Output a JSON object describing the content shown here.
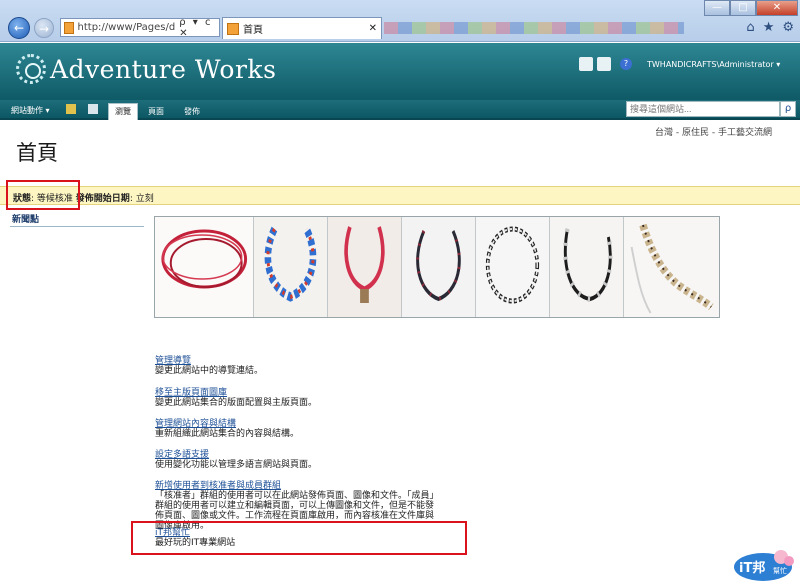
{
  "browser": {
    "address": "http://www/Pages/d",
    "address_controls": "ρ ▾ c ✕",
    "tab_title": "首頁",
    "tab_close": "✕",
    "back_glyph": "←",
    "forward_glyph": "→",
    "controls": [
      "—",
      "□",
      "✕"
    ],
    "right_icons": [
      "⌂",
      "★",
      "⚙"
    ]
  },
  "site": {
    "title": "Adventure Works",
    "user": "TWHANDICRAFTS\\Administrator ▾",
    "help_glyph": "?"
  },
  "ribbon": {
    "site_actions": "網站動作 ▾",
    "tabs": [
      "瀏覽",
      "頁面",
      "發佈"
    ],
    "active_tab": 0,
    "search_placeholder": "搜尋這個網站...",
    "search_glyph": "ρ"
  },
  "page": {
    "breadcrumb": "台灣 - 原住民 - 手工藝交流網",
    "title": "首頁",
    "status_label": "狀態",
    "status_value": ": 等候核准",
    "publish_label": "發佈開始日期",
    "publish_value": ": 立刻",
    "news_heading": "新聞點"
  },
  "links": [
    {
      "title": "管理導覽",
      "desc": "變更此網站中的導覽連結。"
    },
    {
      "title": "移至主版頁面圖庫",
      "desc": "變更此網站集合的版面配置與主版頁面。"
    },
    {
      "title": "管理網站內容與結構",
      "desc": "重新組織此網站集合的內容與結構。"
    },
    {
      "title": "設定多語支援",
      "desc": "使用變化功能以管理多語言網站與頁面。"
    },
    {
      "title": "新增使用者到核准者與成員群組",
      "desc": "「核准者」群組的使用者可以在此網站發佈頁面、圖像和文件。「成員」群組的使用者可以建立和編輯頁面，可以上傳圖像和文件，但是不能發佈頁面、圖像或文件。工作流程在頁面庫啟用，而內容核准在文件庫與圖像庫啟用。"
    },
    {
      "title": "iT邦幫忙",
      "desc": "最好玩的IT專業網站"
    }
  ],
  "logo_badge": {
    "text": "iT邦",
    "sub": "幫忙"
  },
  "colors": {
    "header": "#0e5a66",
    "status_bg": "#fdf6c3",
    "highlight": "#d9121c",
    "link": "#1c4f96"
  }
}
